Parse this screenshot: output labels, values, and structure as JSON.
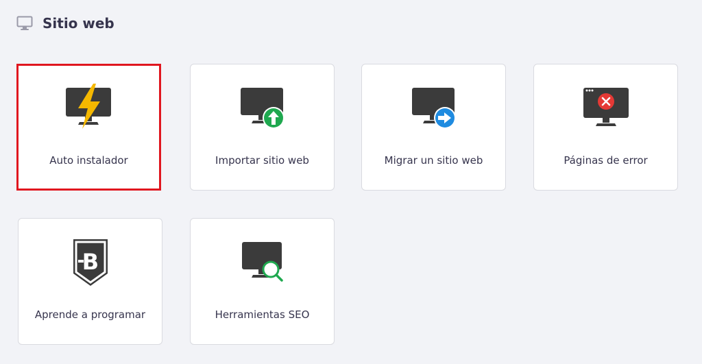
{
  "section": {
    "title": "Sitio web",
    "icon": "monitor-icon"
  },
  "cards": [
    {
      "label": "Auto instalador",
      "icon": "lightning-monitor-icon",
      "selected": true
    },
    {
      "label": "Importar sitio web",
      "icon": "monitor-upload-icon",
      "selected": false
    },
    {
      "label": "Migrar un sitio web",
      "icon": "monitor-arrow-right-icon",
      "selected": false
    },
    {
      "label": "Páginas de error",
      "icon": "monitor-error-icon",
      "selected": false
    },
    {
      "label": "Aprende a programar",
      "icon": "b-shield-icon",
      "selected": false
    },
    {
      "label": "Herramientas SEO",
      "icon": "monitor-search-icon",
      "selected": false
    }
  ],
  "colors": {
    "selection_border": "#e0161f",
    "monitor": "#3b3b3b",
    "lightning": "#f5b800",
    "upload_green": "#1fa84f",
    "arrow_blue": "#1f8be0",
    "error_red": "#e53935",
    "search_green": "#1fa84f"
  }
}
